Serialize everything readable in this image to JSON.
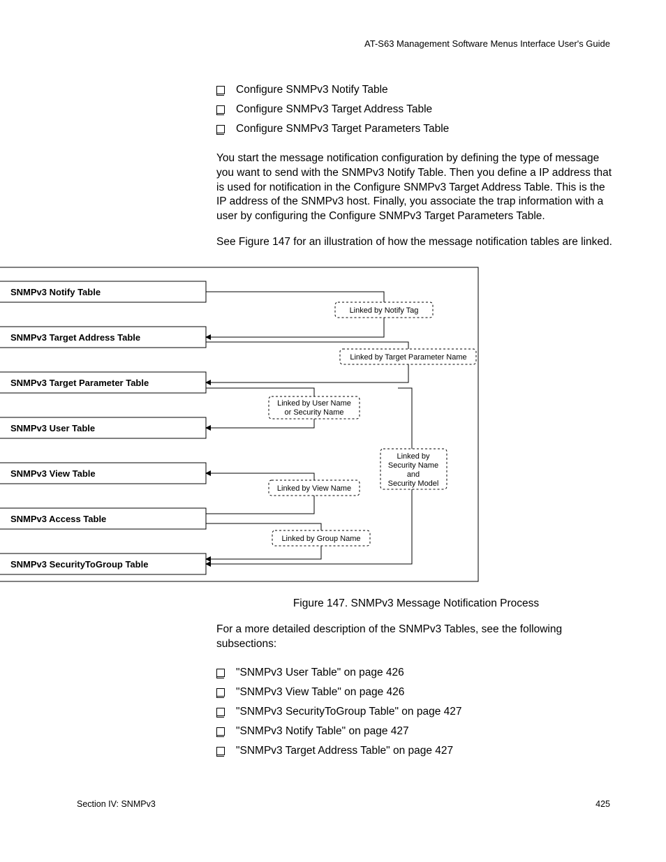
{
  "header": "AT-S63 Management Software Menus Interface User's Guide",
  "topBullets": [
    "Configure SNMPv3 Notify Table",
    "Configure SNMPv3 Target Address Table",
    "Configure SNMPv3 Target Parameters Table"
  ],
  "para1": "You start the message notification configuration by defining the type of message you want to send with the SNMPv3 Notify Table. Then you define a IP address that is used for notification in the Configure SNMPv3 Target Address Table. This is the IP address of the SNMPv3 host. Finally, you associate the trap information with a user by configuring the Configure SNMPv3 Target Parameters Table.",
  "para2": "See Figure 147 for an illustration of how the message notification tables are linked.",
  "figure": {
    "boxes": [
      "SNMPv3 Notify Table",
      "SNMPv3 Target Address Table",
      "SNMPv3 Target Parameter Table",
      "SNMPv3 User Table",
      "SNMPv3 View Table",
      "SNMPv3 Access Table",
      "SNMPv3 SecurityToGroup Table"
    ],
    "links": {
      "notifyTag": "Linked by Notify Tag",
      "targetParam": "Linked by Target Parameter Name",
      "userName1": "Linked by User Name",
      "userName2": "or Security Name",
      "viewName": "Linked by View Name",
      "groupName": "Linked by Group Name",
      "sec1": "Linked by",
      "sec2": "Security Name",
      "sec3": "and",
      "sec4": "Security Model"
    },
    "caption": "Figure 147. SNMPv3 Message Notification Process"
  },
  "para3": "For a more detailed description of the SNMPv3 Tables, see the following subsections:",
  "bottomBullets": [
    "\"SNMPv3 User Table\" on page 426",
    "\"SNMPv3 View Table\" on page 426",
    "\"SNMPv3 SecurityToGroup Table\" on page 427",
    "\"SNMPv3 Notify Table\" on page 427",
    "\"SNMPv3 Target Address Table\" on page 427"
  ],
  "footer": {
    "left": "Section IV: SNMPv3",
    "right": "425"
  }
}
